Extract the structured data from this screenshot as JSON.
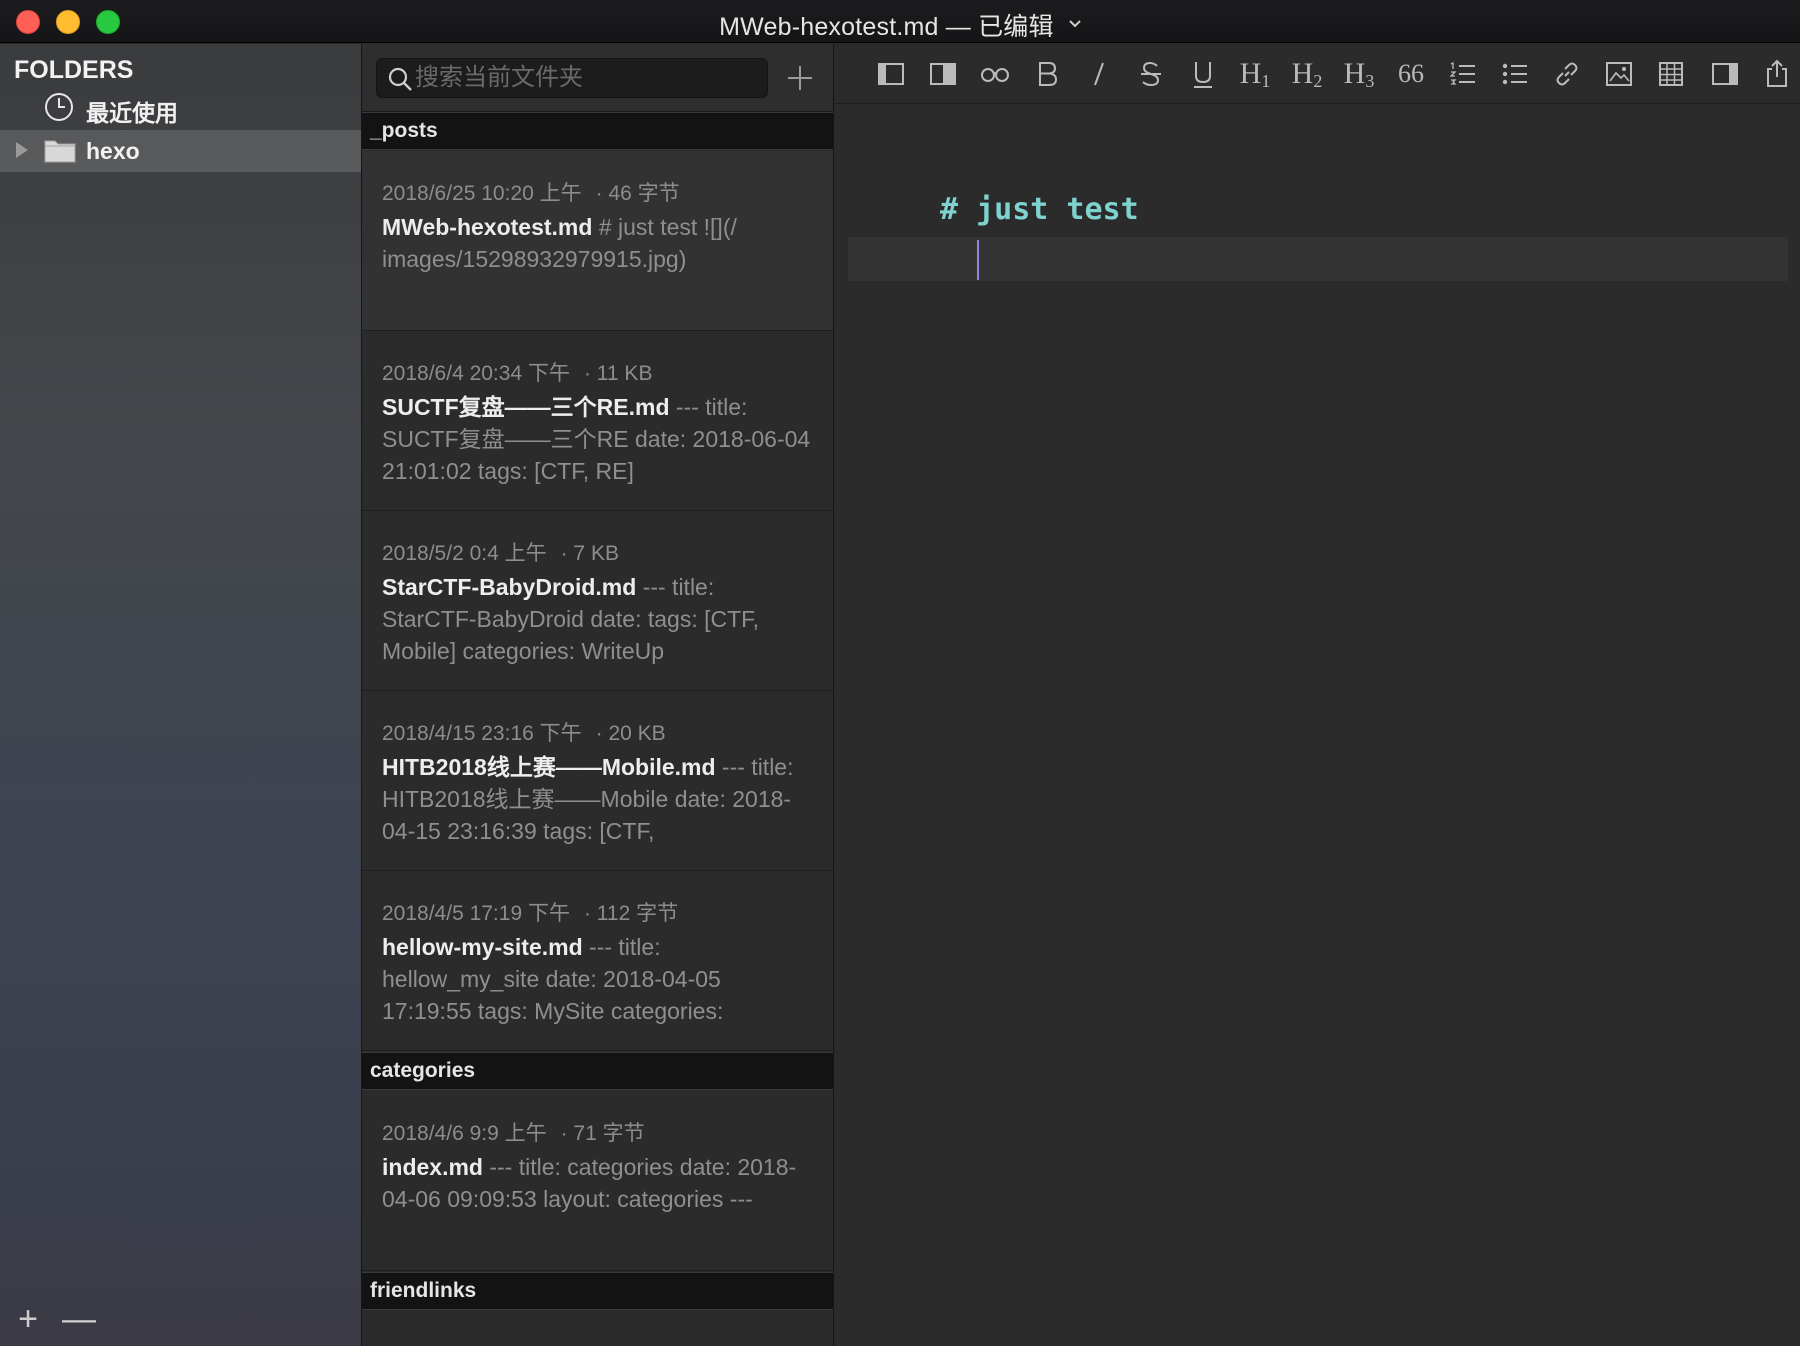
{
  "window": {
    "title": "MWeb-hexotest.md — 已编辑"
  },
  "sidebar": {
    "heading": "FOLDERS",
    "recent_label": "最近使用",
    "folders": [
      {
        "label": "hexo",
        "selected": true,
        "expanded": false
      }
    ],
    "add_button": "+",
    "remove_button": "—"
  },
  "filelist": {
    "search": {
      "placeholder": "搜索当前文件夹",
      "value": ""
    },
    "groups": [
      {
        "name": "_posts"
      },
      {
        "name": "categories"
      },
      {
        "name": "friendlinks"
      }
    ],
    "notes": [
      {
        "date": "2018/6/25 10:20 上午",
        "size": "· 46 字节",
        "filename": "MWeb-hexotest.md",
        "preview": " # just test ![](/ images/15298932979915.jpg)",
        "selected": true
      },
      {
        "date": "2018/6/4 20:34 下午",
        "size": "· 11 KB",
        "filename": "SUCTF复盘——三个RE.md",
        "preview": " --- title: SUCTF复盘——三个RE date: 2018-06-04 21:01:02 tags: [CTF, RE]"
      },
      {
        "date": "2018/5/2 0:4 上午",
        "size": "· 7 KB",
        "filename": "StarCTF-BabyDroid.md",
        "preview": " --- title: StarCTF-BabyDroid date:  tags: [CTF, Mobile] categories: WriteUp"
      },
      {
        "date": "2018/4/15 23:16 下午",
        "size": "· 20 KB",
        "filename": "HITB2018线上赛——Mobile.md",
        "preview": " --- title: HITB2018线上赛——Mobile date: 2018-04-15 23:16:39 tags: [CTF,"
      },
      {
        "date": "2018/4/5 17:19 下午",
        "size": "· 112 字节",
        "filename": "hellow-my-site.md",
        "preview": " --- title: hellow_my_site date: 2018-04-05 17:19:55 tags: MySite categories:"
      },
      {
        "date": "2018/4/6 9:9 上午",
        "size": "· 71 字节",
        "filename": "index.md",
        "preview": " --- title: categories date: 2018-04-06 09:09:53 layout: categories ---"
      }
    ]
  },
  "editor": {
    "toolbar": {
      "h1": "H",
      "h1_sub": "1",
      "h2": "H",
      "h2_sub": "2",
      "h3": "H",
      "h3_sub": "3",
      "quote": "66"
    },
    "content_line_1": "# just test",
    "accent_color": "#7fd3cf"
  }
}
